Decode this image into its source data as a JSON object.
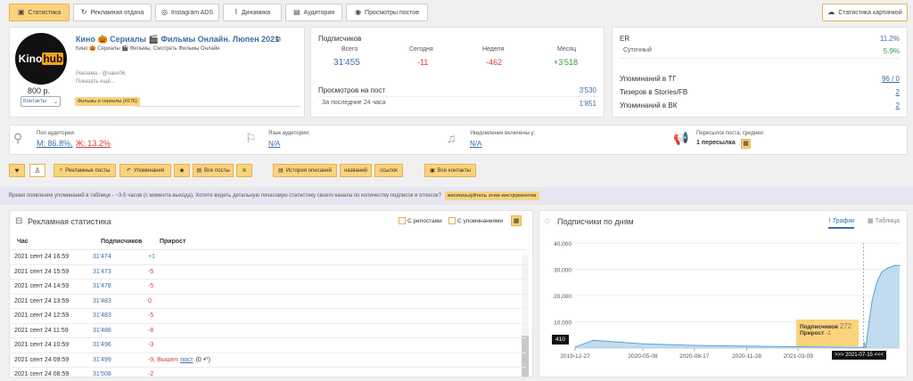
{
  "tabs": [
    {
      "label": "Статистика",
      "icon": "chart-icon"
    },
    {
      "label": "Рекламная отдача",
      "icon": "refresh-icon"
    },
    {
      "label": "Instagram ADS",
      "icon": "instagram-icon"
    },
    {
      "label": "Динамика",
      "icon": "chart-line-icon"
    },
    {
      "label": "Аудитория",
      "icon": "chart-bar-icon"
    },
    {
      "label": "Просмотры постов",
      "icon": "eye-icon"
    }
  ],
  "stat_picture_label": "Статистика картинкой",
  "channel": {
    "logo_text_1": "Kino",
    "logo_text_2": "hub",
    "title": "Кино 🎃 Сериалы 🎬 Фильмы Онлайн. Люпен 2021",
    "subtitle": "Кино 🎃 Сериалы 🎬 Фильмы. Смотреть Фильмы Онлайн",
    "price": "800 р.",
    "contacts": "Контакты",
    "ad_label": "Реклама - @nake06",
    "show_more": "Показать ещё...",
    "category": "Фильмы и сериалы (#276)"
  },
  "subscribers": {
    "title": "Подписчиков",
    "cols": [
      {
        "label": "Всего",
        "value": "31'455"
      },
      {
        "label": "Сегодня",
        "value": "-11"
      },
      {
        "label": "Неделя",
        "value": "-462"
      },
      {
        "label": "Месяц",
        "value": "+3'518"
      }
    ],
    "views_label": "Просмотров на пост",
    "views_value": "3'530",
    "last24_label": "За последние 24 часа",
    "last24_value": "1'851"
  },
  "er": {
    "er_label": "ER",
    "er_value": "11.2%",
    "daily_label": "Суточный",
    "daily_value": "5.9%",
    "mentions_label": "Упоминаний в ТГ",
    "mentions_value": "96 / 0",
    "teasers_label": "Тизеров в Stories/FB",
    "teasers_value": "2",
    "vk_label": "Упоминаний в ВК",
    "vk_value": "2"
  },
  "audience": {
    "gender_label": "Пол аудитории:",
    "gender_m": "М: 86.8%,",
    "gender_f": "Ж: 13.2%",
    "lang_label": "Язык аудитории:",
    "lang_value": "N/A",
    "notif_label": "Уведомления включены у:",
    "notif_value": "N/A",
    "forwards_label": "Пересылок поста, среднее:",
    "forwards_value": "1 пересылка"
  },
  "actions": {
    "ad_posts": "Рекламные посты",
    "mentions": "Упоминания",
    "all_posts": "Все посты",
    "history": "История описаний",
    "names": "названий",
    "links": "ссылок",
    "all_contacts": "Все контакты"
  },
  "notice": {
    "text": "Время появления упоминаний в таблице - ~3-5 часов (с момента выхода). Хотите видеть детальную почасовую статистику своего канала по количеству подписок и отписок?",
    "button": "воспользуйтесь этим инструментом"
  },
  "ad_stats": {
    "title": "Рекламная статистика",
    "reposts": "С репостами",
    "mentions": "С упоминаниями",
    "headers": [
      "Час",
      "Подписчиков",
      "Прирост"
    ],
    "rows": [
      {
        "time": "2021 сент 24 16:59",
        "subs": "31'474",
        "delta": "+1",
        "kind": "pos"
      },
      {
        "time": "2021 сент 24 15:59",
        "subs": "31'473",
        "delta": "-5",
        "kind": "neg"
      },
      {
        "time": "2021 сент 24 14:59",
        "subs": "31'478",
        "delta": "-5",
        "kind": "neg"
      },
      {
        "time": "2021 сент 24 13:59",
        "subs": "31'483",
        "delta": "0",
        "kind": "neg"
      },
      {
        "time": "2021 сент 24 12:59",
        "subs": "31'483",
        "delta": "-5",
        "kind": "neg"
      },
      {
        "time": "2021 сент 24 11:59",
        "subs": "31'488",
        "delta": "-8",
        "kind": "neg"
      },
      {
        "time": "2021 сент 24 10:59",
        "subs": "31'496",
        "delta": "-3",
        "kind": "neg"
      },
      {
        "time": "2021 сент 24 09:59",
        "subs": "31'499",
        "delta": "-9, Вышел",
        "link": "пост",
        "extra": "(0 ↶)",
        "kind": "neg"
      },
      {
        "time": "2021 сент 24 08:59",
        "subs": "31'508",
        "delta": "-2",
        "kind": "neg"
      }
    ]
  },
  "subs_by_day": {
    "title": "Подписчики по дням",
    "tab_chart": "График",
    "tab_table": "Таблица",
    "tooltip_subs_label": "Подписчиков",
    "tooltip_subs_value": "272",
    "tooltip_growth_label": "Прирост",
    "tooltip_growth_value": "-1",
    "start_badge": "410",
    "date_badge": ">>> 2021-07-15 <<<"
  },
  "chart_data": {
    "type": "area",
    "yticks": [
      "40,000",
      "30,000",
      "20,000",
      "10,000"
    ],
    "ylim": [
      0,
      40000
    ],
    "xticks": [
      "2019-12-27",
      "2020-05-08",
      "2020-08-17",
      "2020-11-28",
      "2021-03-09"
    ],
    "x": [
      "2019-12-27",
      "2020-02-01",
      "2020-05-08",
      "2020-08-17",
      "2020-11-28",
      "2021-03-09",
      "2021-07-10",
      "2021-07-14",
      "2021-07-15",
      "2021-07-17",
      "2021-07-18",
      "2021-07-20",
      "2021-07-22",
      "2021-07-26",
      "2021-08-01",
      "2021-08-10",
      "2021-08-20",
      "2021-09-01",
      "2021-09-15",
      "2021-09-24"
    ],
    "values": [
      410,
      3000,
      1600,
      1000,
      700,
      500,
      300,
      290,
      272,
      2000,
      300,
      260,
      4000,
      10000,
      18000,
      25000,
      29000,
      30500,
      31500,
      31474
    ],
    "color": "#a7cde8",
    "line_color": "#5aa2d4"
  },
  "colors": {
    "accent": "#fbd37b",
    "link": "#3a6ea5",
    "neg": "#d43b3b",
    "pos": "#3c9a3c"
  }
}
